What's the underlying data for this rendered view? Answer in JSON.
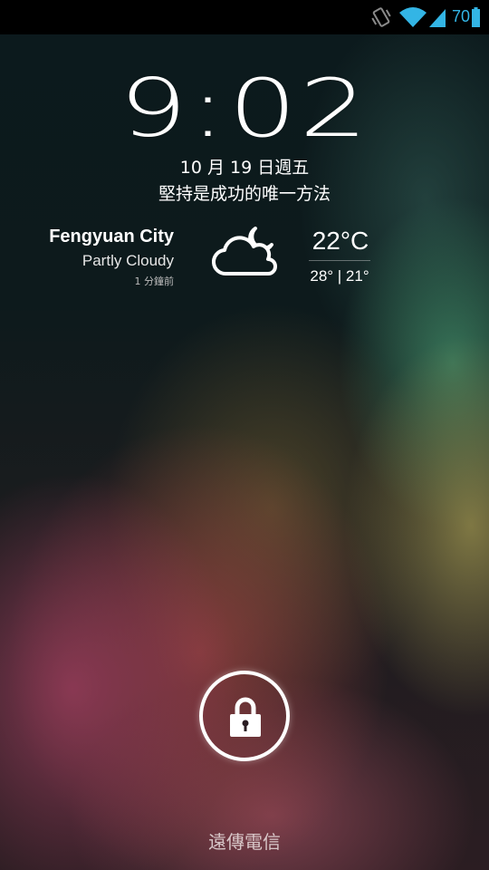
{
  "status_bar": {
    "battery_level": "70",
    "accent_color": "#33b5e5",
    "icons": [
      "vibrate-icon",
      "wifi-icon",
      "cell-signal-icon",
      "battery-icon"
    ]
  },
  "lockscreen": {
    "time": "9:02",
    "date": "10 月 19 日週五",
    "owner_info": "堅持是成功的唯一方法"
  },
  "weather": {
    "city": "Fengyuan City",
    "condition": "Partly Cloudy",
    "updated": "1 分鐘前",
    "icon": "partly-cloudy-night-icon",
    "temperature": "22°C",
    "high_low": "28° | 21°"
  },
  "unlock": {
    "icon": "lock-icon"
  },
  "carrier": {
    "name": "遠傳電信"
  }
}
